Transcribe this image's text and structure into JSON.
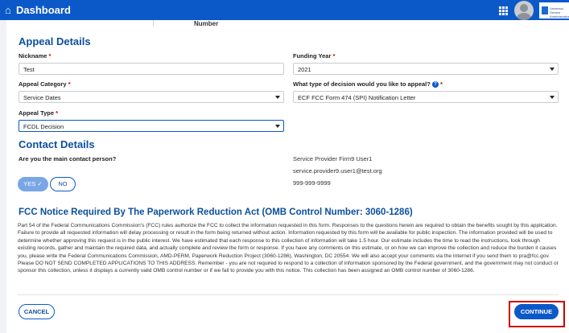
{
  "topbar": {
    "title": "Dashboard",
    "home_glyph": "⌂",
    "apps_icon": "grid-icon",
    "logo_text": "Universal Service Administrative Co."
  },
  "cut_off": {
    "label": "Number"
  },
  "appeal": {
    "heading": "Appeal Details",
    "nickname": {
      "label": "Nickname",
      "required": "*",
      "value": "Test"
    },
    "funding_year": {
      "label": "Funding Year",
      "required": "*",
      "value": "2021"
    },
    "category": {
      "label": "Appeal Category",
      "required": "*",
      "value": "Service Dates"
    },
    "decision": {
      "label": "What type of decision would you like to appeal?",
      "help": "?",
      "required": "*",
      "value": "ECF FCC Form 474 (SPI) Notification Letter"
    },
    "type": {
      "label": "Appeal Type",
      "required": "*",
      "value": "FCDL Decision"
    }
  },
  "contact": {
    "heading": "Contact Details",
    "question": "Are you the main contact person?",
    "yes_label": "YES ✓",
    "no_label": "NO",
    "name": "Service Provider Firm9 User1",
    "email": "service.provider9.user1@test.org",
    "phone": "999-999-9999"
  },
  "notice": {
    "heading": "FCC Notice Required By The Paperwork Reduction Act (OMB Control Number: 3060-1286)",
    "body": "Part 54 of the Federal Communications Commission's (FCC) rules authorize the FCC to collect the information requested in this form. Responses to the questions herein are required to obtain the benefits sought by this application. Failure to provide all requested information will delay processing or result in the form being returned without action. Information requested by this form will be available for public inspection. The information provided will be used to determine whether approving this request is in the public interest. We have estimated that each response to this collection of information will take 1.5 hour. Our estimate includes the time to read the instructions, look through existing records, gather and maintain the required data, and actually complete and review the form or response. If you have any comments on this estimate, or on how we can improve the collection and reduce the burden it causes you, please write the Federal Communications Commission, AMD-PERM, Paperwork Reduction Project (3060-1286), Washington, DC 20554. We will also accept your comments via the Internet if you send them to pra@fcc.gov. Please DO NOT SEND COMPLETED APPLICATIONS TO THIS ADDRESS. Remember - you are not required to respond to a collection of information sponsored by the Federal government, and the government may not conduct or sponsor this collection, unless it displays a currently valid OMB control number or if we fail to provide you with this notice. This collection has been assigned an OMB control number of 3060-1286."
  },
  "actions": {
    "cancel_label": "CANCEL",
    "continue_label": "CONTINUE"
  },
  "colors": {
    "brand": "#0b59c9",
    "heading": "#0b4f9e",
    "required": "#cc0000",
    "highlight": "#d00000"
  }
}
